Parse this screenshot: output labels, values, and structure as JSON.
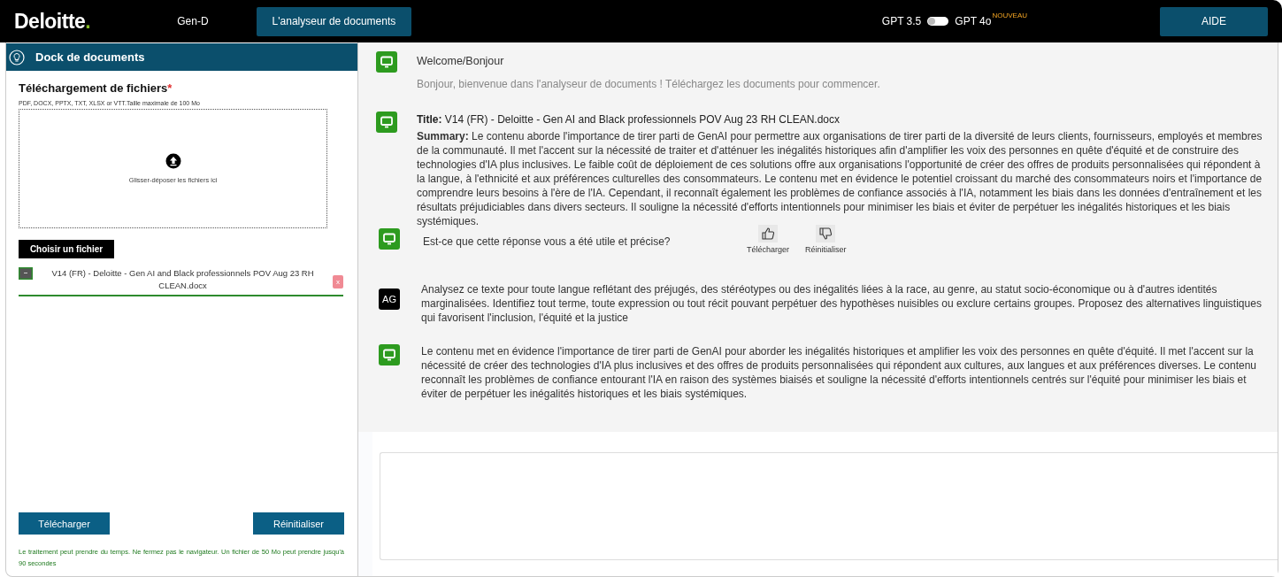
{
  "navbar": {
    "logo": {
      "text": "Deloitte",
      "dot": "."
    },
    "tabs": [
      {
        "label": "Gen-D",
        "selected": false
      },
      {
        "label": "L'analyseur de documents",
        "selected": true
      }
    ],
    "model_toggle": {
      "left_label": "GPT 3.5",
      "right_label": "GPT 4o",
      "badge": "NOUVEAU",
      "on": false
    },
    "help_button": "AIDE"
  },
  "sidebar": {
    "title": "Dock de documents",
    "upload": {
      "heading": "Téléchargement de fichiers",
      "required_mark": "*",
      "hint": "PDF, DOCX, PPTX, TXT, XLSX or VTT.Taille maximale de 100 Mo",
      "dropzone_text": "Glisser-déposer les fichiers ici",
      "choose_button": "Choisir un fichier"
    },
    "files": [
      {
        "name": "V14 (FR) - Deloitte - Gen AI and Black professionnels POV Aug 23 RH CLEAN.docx",
        "remove": "x"
      }
    ],
    "buttons": [
      "Télécharger",
      "Réinitialiser"
    ],
    "note": "Le traitement peut prendre du temps. Ne fermez pas le navigateur. Un fichier de 50 Mo peut prendre jusqu'à 90 secondes"
  },
  "chat": {
    "messages": [
      {
        "kind": "welcome",
        "title": "Welcome/Bonjour",
        "text": "Bonjour, bienvenue dans l'analyseur de documents ! Téléchargez les documents pour commencer."
      },
      {
        "kind": "summary",
        "title": "**Title:** V14 (FR) - Deloitte - Gen AI and Black professionnels POV Aug 23 RH CLEAN.docx",
        "text": "**Summary:** Le contenu aborde l'importance de tirer parti de GenAI pour permettre aux organisations de tirer parti de la diversité de leurs clients, fournisseurs, employés et membres de la communauté. Il met l'accent sur la nécessité de traiter et d'atténuer les inégalités historiques afin d'amplifier les voix des personnes en quête d'équité et de construire des technologies d'IA plus inclusives. Le faible coût de déploiement de ces solutions offre aux organisations l'opportunité de créer des offres de produits personnalisées qui répondent à la langue, à l'ethnicité et aux préférences culturelles des consommateurs. Le contenu met en évidence le potentiel croissant du marché des consommateurs noirs et l'importance de comprendre leurs besoins à l'ère de l'IA. Cependant, il reconnaît également les problèmes de confiance associés à l'IA, notamment les biais dans les données d'entraînement et les résultats préjudiciables dans divers secteurs. Il souligne la nécessité d'efforts intentionnels pour minimiser les biais et éviter de perpétuer les inégalités historiques et les biais systémiques."
      },
      {
        "kind": "feedback",
        "text": "Est-ce que cette réponse vous a été utile et précise?",
        "actions": [
          {
            "kind": "up",
            "label": "Télécharger"
          },
          {
            "kind": "down",
            "label": "Réinitialiser"
          }
        ]
      },
      {
        "kind": "user",
        "avatar": "AG",
        "text": "Analysez ce texte pour toute langue reflétant des préjugés, des stéréotypes ou des inégalités liées à la race, au genre, au statut socio-économique ou à d'autres identités marginalisées. Identifiez tout terme, toute expression ou tout récit pouvant perpétuer des hypothèses nuisibles ou exclure certains groupes. Proposez des alternatives linguistiques qui favorisent l'inclusion, l'équité et la justice"
      },
      {
        "kind": "bot",
        "text": "Le contenu met en évidence l'importance de tirer parti de GenAI pour aborder les inégalités historiques et amplifier les voix des personnes en quête d'équité. Il met l'accent sur la nécessité de créer des technologies d'IA plus inclusives et des offres de produits personnalisées qui répondent aux cultures, aux langues et aux préférences diverses. Le contenu reconnaît les problèmes de confiance entourant l'IA en raison des systèmes biaisés et souligne la nécessité d'efforts intentionnels centrés sur l'équité pour minimiser les biais et éviter de perpétuer les inégalités historiques et les biais systémiques."
      }
    ]
  }
}
